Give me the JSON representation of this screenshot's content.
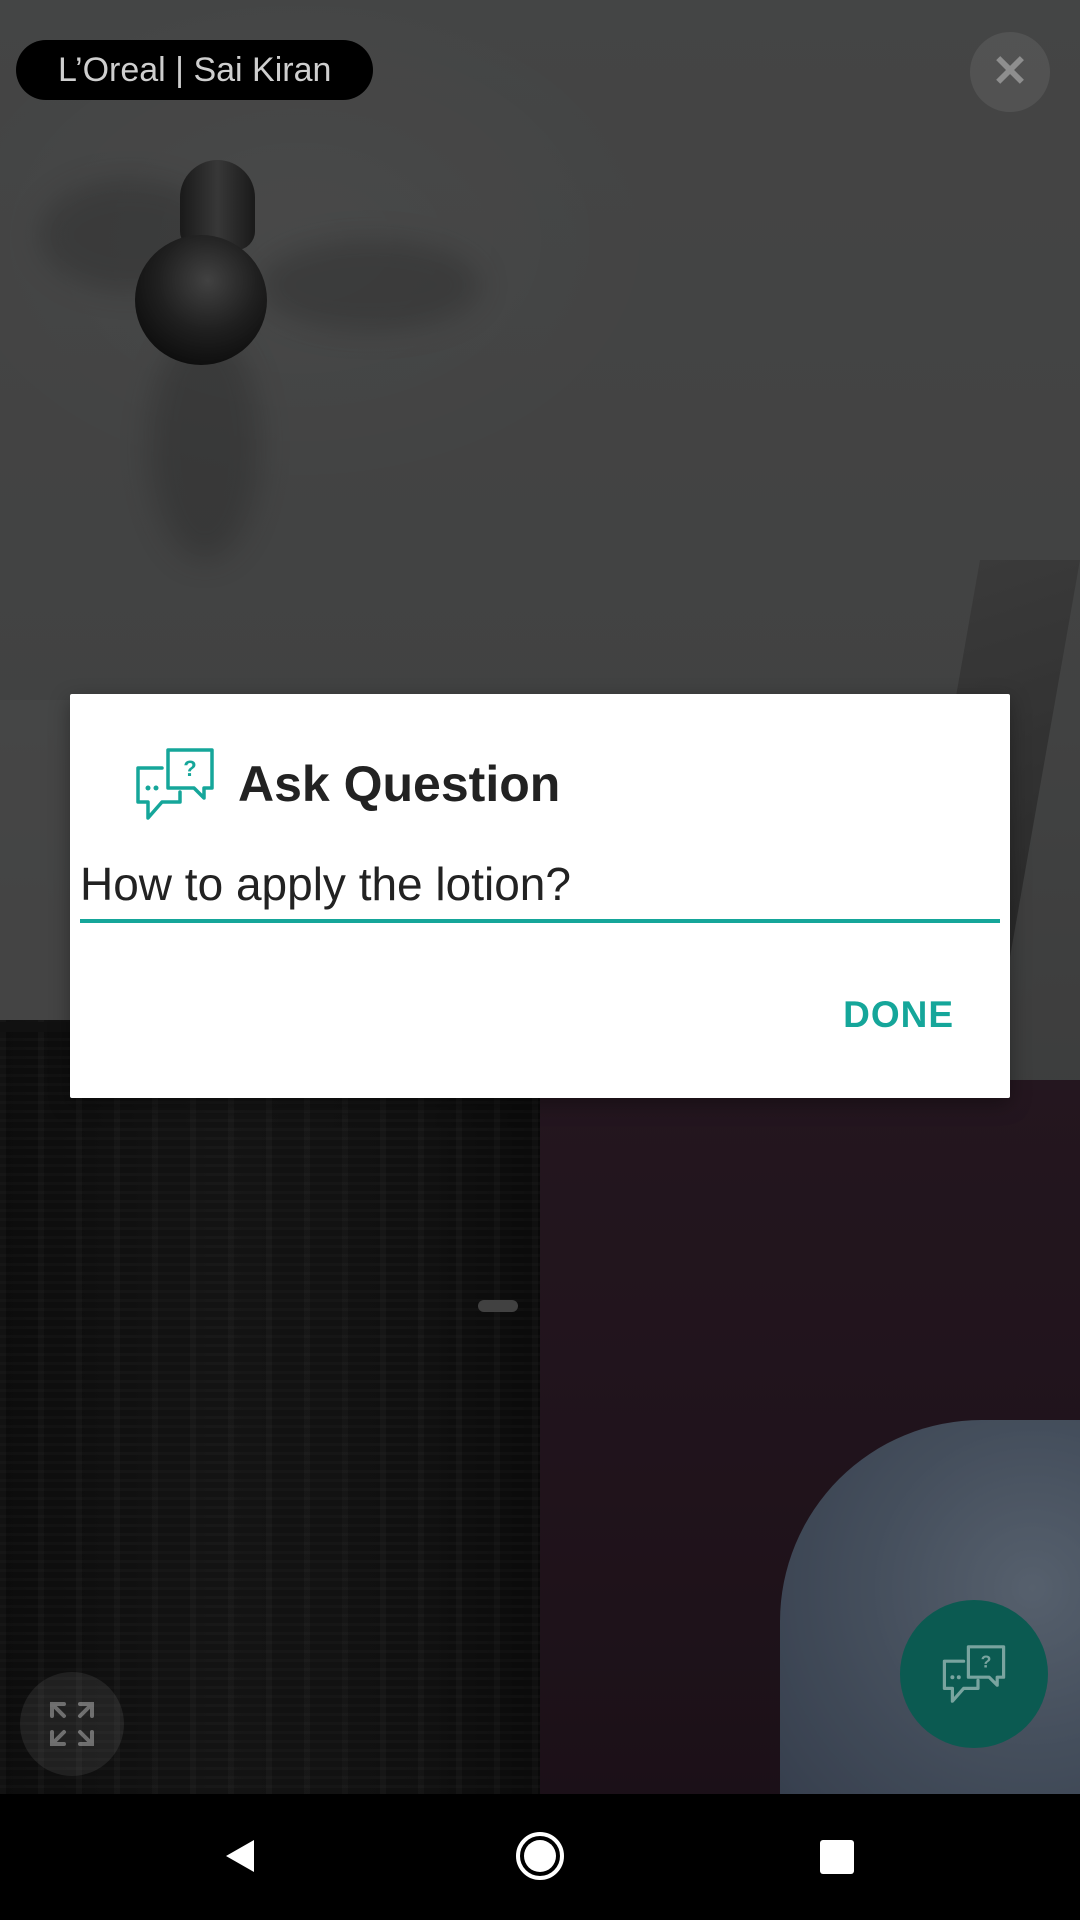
{
  "session": {
    "label": "L’Oreal | Sai Kiran"
  },
  "close": {
    "glyph": "✕"
  },
  "dialog": {
    "title": "Ask Question",
    "input_value": "How to apply the lotion?",
    "done_label": "DONE"
  },
  "icons": {
    "close": "close-icon",
    "dialog": "chat-question-icon",
    "fullscreen": "fullscreen-icon",
    "fab": "chat-question-icon",
    "nav_back": "back-triangle-icon",
    "nav_home": "home-circle-icon",
    "nav_recents": "recents-square-icon"
  },
  "colors": {
    "accent": "#15a69a",
    "fab_background": "#0b5a51",
    "pill_background": "#000000"
  }
}
